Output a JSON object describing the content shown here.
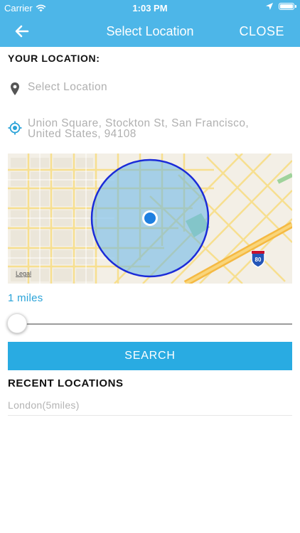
{
  "status_bar": {
    "carrier": "Carrier",
    "time": "1:03 PM",
    "icons": [
      "wifi-icon",
      "location-arrow-icon",
      "battery-icon"
    ]
  },
  "nav": {
    "title": "Select Location",
    "close_label": "CLOSE",
    "back_icon": "arrow-left-icon",
    "bg_color": "#4db6e8"
  },
  "location": {
    "section_label": "YOUR LOCATION:",
    "input_placeholder": "Select Location",
    "current_line1": "Union Square, Stockton St, San Francisco,",
    "current_line2": "United States, 94108"
  },
  "map": {
    "legal_label": "Legal",
    "highway_label": "80",
    "radius_fill": "#64b4e8",
    "radius_stroke": "#1b2bd8"
  },
  "radius": {
    "label": "1 miles",
    "value_miles": 1,
    "slider_fraction": 0.0
  },
  "actions": {
    "search_label": "SEARCH",
    "search_color": "#29abe2"
  },
  "recent": {
    "section_label": "RECENT LOCATIONS",
    "items": [
      "London(5miles)"
    ]
  }
}
